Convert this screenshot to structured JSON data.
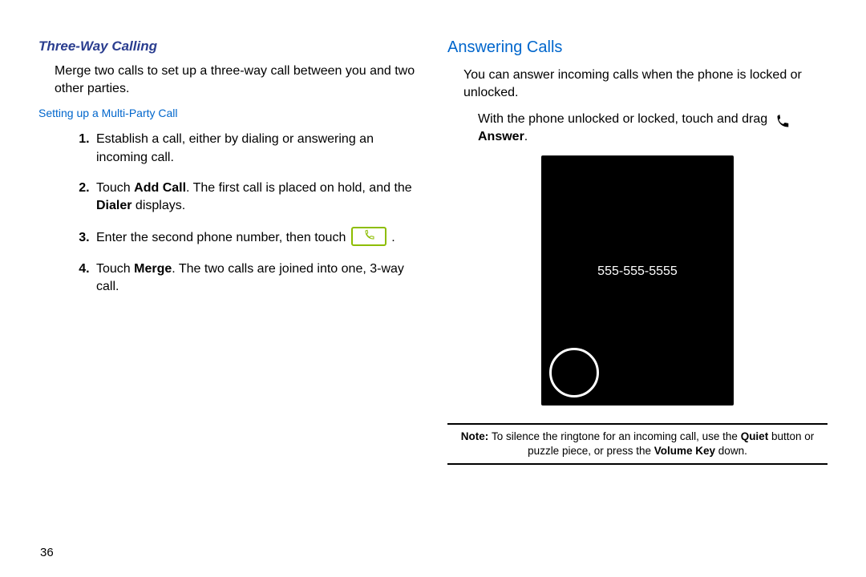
{
  "page_number": "36",
  "left": {
    "heading": "Three-Way Calling",
    "intro": "Merge two calls to set up a three-way call between you and two other parties.",
    "procedure_heading": "Setting up a Multi-Party Call",
    "steps": {
      "s1": "Establish a call, either by dialing or answering an incoming call.",
      "s2a": "Touch ",
      "s2b": "Add Call",
      "s2c": ". The first call is placed on hold, and the ",
      "s2d": "Dialer",
      "s2e": " displays.",
      "s3a": "Enter the second phone number, then touch ",
      "s3b": " .",
      "s4a": "Touch ",
      "s4b": "Merge",
      "s4c": ". The two calls are joined into one, 3-way call."
    }
  },
  "right": {
    "heading": "Answering Calls",
    "intro": "You can answer incoming calls when the phone is locked or unlocked.",
    "line2a": "With the phone unlocked or locked, touch and drag ",
    "line2_answer": "Answer",
    "line2b": ".",
    "phone_number": "555-555-5555",
    "note": {
      "lead": "Note: ",
      "t1": "To silence the ringtone for an incoming call, use the ",
      "b1": "Quiet",
      "t2": " button or puzzle piece, or press the ",
      "b2": "Volume Key",
      "t3": " down."
    }
  }
}
